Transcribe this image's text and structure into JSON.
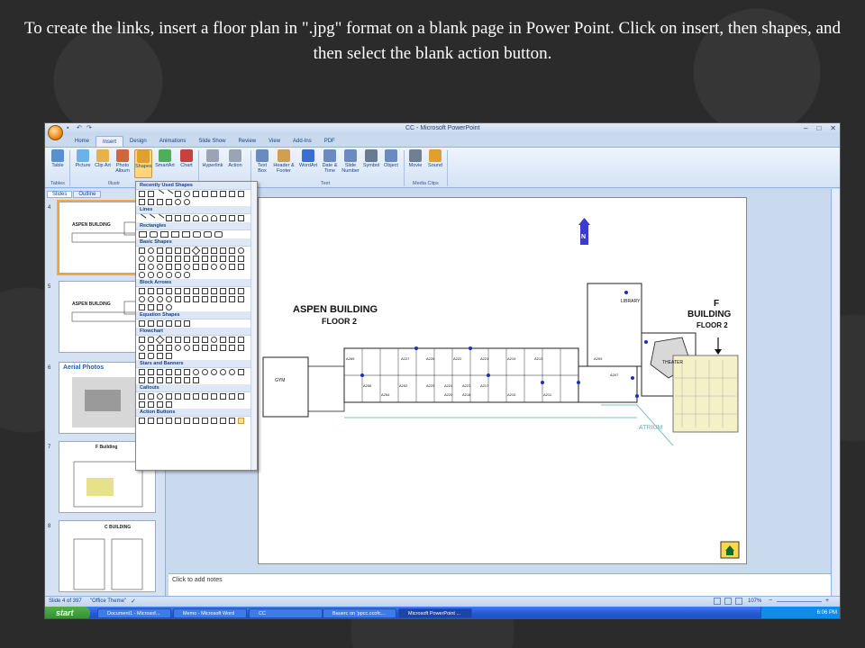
{
  "caption": "To create the links, insert a floor plan in \".jpg\" format on a blank page in Power Point.  Click on insert, then shapes, and then select the blank action button.",
  "window": {
    "title": "CC - Microsoft PowerPoint"
  },
  "ribbon_tabs": [
    "Home",
    "Insert",
    "Design",
    "Animations",
    "Slide Show",
    "Review",
    "View",
    "Add-Ins",
    "PDF"
  ],
  "active_tab": "Insert",
  "ribbon": {
    "buttons": [
      {
        "label": "Table",
        "color": "#5a8fd0"
      },
      {
        "label": "Picture",
        "color": "#6bb2e8"
      },
      {
        "label": "Clip Art",
        "color": "#e8b24a"
      },
      {
        "label": "Photo Album",
        "color": "#d0663c"
      },
      {
        "label": "Shapes",
        "color": "#e0a030"
      },
      {
        "label": "SmartArt",
        "color": "#4fae5a"
      },
      {
        "label": "Chart",
        "color": "#c84040"
      },
      {
        "label": "Hyperlink",
        "color": "#9aa4b4"
      },
      {
        "label": "Action",
        "color": "#9aa4b4"
      },
      {
        "label": "Text Box",
        "color": "#6a8ac0"
      },
      {
        "label": "Header & Footer",
        "color": "#d0a050"
      },
      {
        "label": "WordArt",
        "color": "#3a6ed0"
      },
      {
        "label": "Date & Time",
        "color": "#6a8ac0"
      },
      {
        "label": "Slide Number",
        "color": "#6a8ac0"
      },
      {
        "label": "Symbol",
        "color": "#6a7a90"
      },
      {
        "label": "Object",
        "color": "#6a8ac0"
      },
      {
        "label": "Movie",
        "color": "#708090"
      },
      {
        "label": "Sound",
        "color": "#e0a030"
      }
    ],
    "groups": [
      "Tables",
      "Illustr",
      "Text",
      "Media Clips"
    ]
  },
  "slides_pane": {
    "tabs": [
      "Slides",
      "Outline"
    ],
    "thumbnails": [
      {
        "number": "4",
        "title": "ASPEN BUILDING"
      },
      {
        "number": "5",
        "title": "ASPEN BUILDING"
      },
      {
        "number": "6",
        "title": "Aerial Photos"
      },
      {
        "number": "7",
        "title": "F Building"
      },
      {
        "number": "8",
        "title": "C BUILDING"
      }
    ]
  },
  "shapes_menu": {
    "sections": [
      "Recently Used Shapes",
      "Lines",
      "Rectangles",
      "Basic Shapes",
      "Block Arrows",
      "Equation Shapes",
      "Flowchart",
      "Stars and Banners",
      "Callouts",
      "Action Buttons"
    ]
  },
  "slide": {
    "aspen_title": "ASPEN BUILDING",
    "aspen_floor": "FLOOR 2",
    "f_title_1": "F",
    "f_title_2": "BUILDING",
    "f_floor": "FLOOR 2",
    "north": "N",
    "library_label": "LIBRARY",
    "theater_label": "THEATER",
    "atrium_label": "ATRIUM",
    "gym_label": "GYM",
    "rooms": [
      "A269",
      "A227",
      "A226",
      "A222",
      "A221",
      "A219",
      "A217",
      "A218",
      "A215",
      "A213",
      "A209",
      "A207",
      "A256",
      "A254",
      "A252",
      "A225",
      "A224",
      "A223",
      "A220",
      "A211"
    ]
  },
  "notes_placeholder": "Click to add notes",
  "status": {
    "slide_info": "Slide 4 of 397",
    "theme": "\"Office Theme\"",
    "zoom": "107%"
  },
  "taskbar": {
    "start": "start",
    "items": [
      "Document1 - Microsof...",
      "Memo - Microsoft Word",
      "CC",
      "Bauerc on 'ppcc.ccofc...",
      "Microsoft PowerPoint ..."
    ],
    "time": "6:06 PM"
  }
}
